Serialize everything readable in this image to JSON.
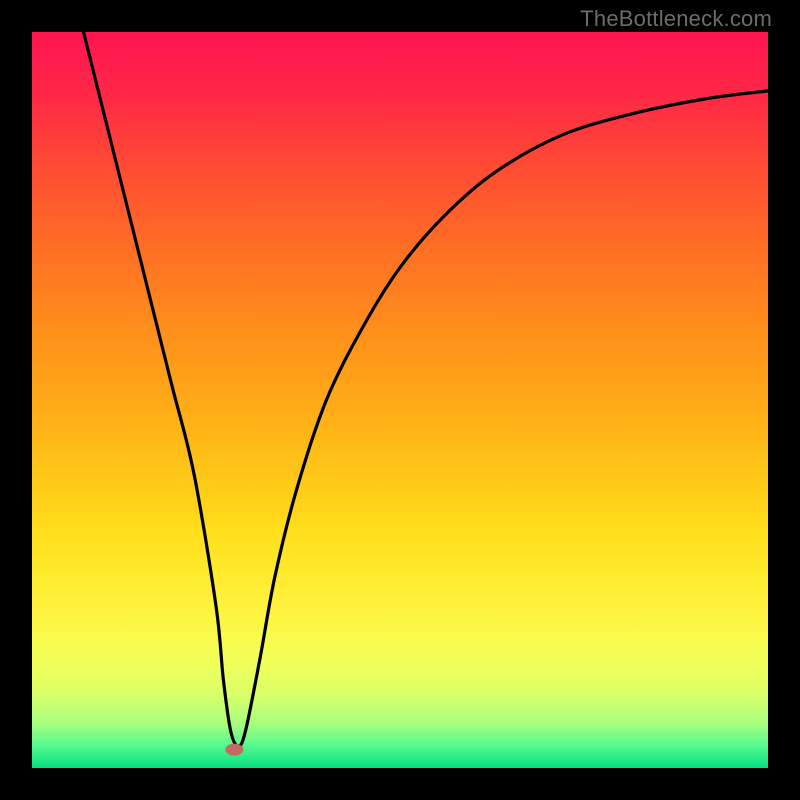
{
  "watermark": "TheBottleneck.com",
  "chart_data": {
    "type": "line",
    "title": "",
    "xlabel": "",
    "ylabel": "",
    "xlim": [
      0,
      100
    ],
    "ylim": [
      0,
      100
    ],
    "grid": false,
    "series": [
      {
        "name": "bottleneck-curve",
        "x": [
          7,
          10,
          13,
          16,
          19,
          22,
          25,
          26,
          27,
          28,
          29,
          31,
          33,
          36,
          40,
          45,
          50,
          56,
          63,
          72,
          82,
          92,
          100
        ],
        "y": [
          100,
          88,
          76,
          64,
          52,
          40,
          22,
          12,
          5,
          3,
          5,
          15,
          26,
          38,
          50,
          60,
          68,
          75,
          81,
          86,
          89,
          91,
          92
        ]
      }
    ],
    "marker": {
      "name": "min-point",
      "x": 27.5,
      "y": 2.5,
      "color": "#c46a62",
      "rx": 9,
      "ry": 6
    },
    "background": {
      "type": "vertical-gradient",
      "stops": [
        {
          "pos": 0.0,
          "color": "#ff1550"
        },
        {
          "pos": 0.08,
          "color": "#ff2647"
        },
        {
          "pos": 0.18,
          "color": "#ff4a34"
        },
        {
          "pos": 0.3,
          "color": "#ff7023"
        },
        {
          "pos": 0.42,
          "color": "#ff931a"
        },
        {
          "pos": 0.55,
          "color": "#ffb716"
        },
        {
          "pos": 0.68,
          "color": "#ffdf1b"
        },
        {
          "pos": 0.78,
          "color": "#fff23c"
        },
        {
          "pos": 0.85,
          "color": "#f4ff56"
        },
        {
          "pos": 0.9,
          "color": "#d9ff68"
        },
        {
          "pos": 0.94,
          "color": "#a6ff7e"
        },
        {
          "pos": 0.97,
          "color": "#55f98f"
        },
        {
          "pos": 1.0,
          "color": "#04e07f"
        }
      ]
    }
  }
}
